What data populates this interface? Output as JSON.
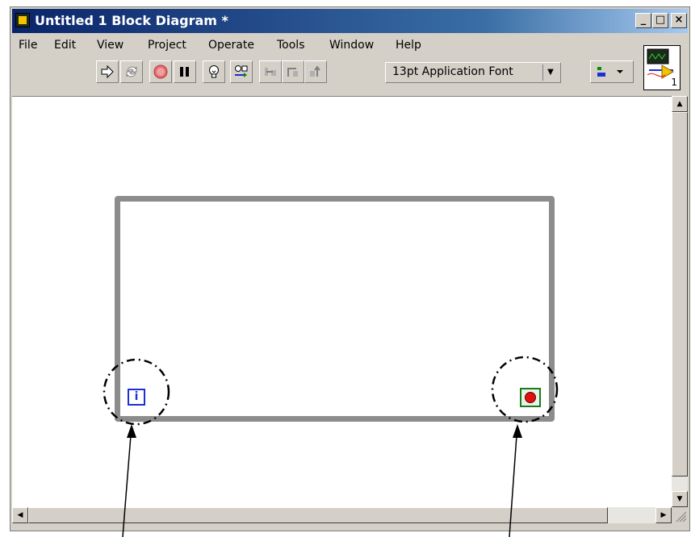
{
  "window": {
    "title": "Untitled 1 Block Diagram *",
    "controls": {
      "minimize": "_",
      "maximize": "□",
      "close": "×"
    }
  },
  "menubar": {
    "items": [
      {
        "label": "File"
      },
      {
        "label": "Edit"
      },
      {
        "label": "View"
      },
      {
        "label": "Project"
      },
      {
        "label": "Operate"
      },
      {
        "label": "Tools"
      },
      {
        "label": "Window"
      },
      {
        "label": "Help"
      }
    ]
  },
  "toolbar": {
    "buttons": [
      "run-arrow-icon",
      "run-continuously-icon",
      "abort-icon",
      "pause-icon",
      "highlight-execution-icon",
      "retain-wire-values-icon",
      "step-into-icon",
      "step-over-icon",
      "step-out-icon"
    ],
    "font_select": {
      "value": "13pt Application Font"
    }
  },
  "connector_pane": {
    "number": "1"
  },
  "diagram": {
    "structure": "while-loop",
    "iteration_terminal": {
      "label": "i",
      "color": "#1e2fd4"
    },
    "conditional_terminal": {
      "icon": "stop-if-true-icon",
      "color": "#1a7a1a"
    },
    "loop_color": "#8c8c8c"
  }
}
